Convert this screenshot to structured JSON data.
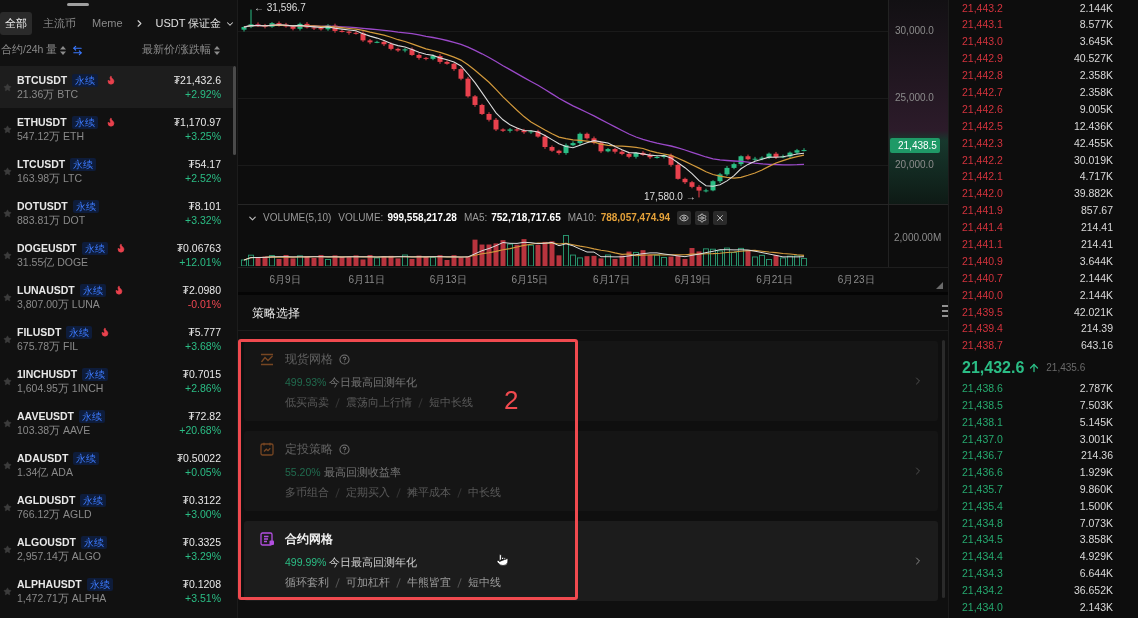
{
  "sidebar": {
    "tabs": [
      {
        "label": "全部",
        "selected": true
      },
      {
        "label": "主流币",
        "selected": false
      },
      {
        "label": "Meme",
        "selected": false
      }
    ],
    "market_select": {
      "label": "USDT 保证金"
    },
    "columns": {
      "left": "合约/24h 量",
      "right": "最新价/涨跌幅"
    },
    "rows": [
      {
        "symbol": "BTCUSDT",
        "tag": "永续",
        "hot": true,
        "volume": "21.36万 BTC",
        "price": "₮21,432.6",
        "change": "+2.92%",
        "rising": true,
        "starred": false,
        "selected": true
      },
      {
        "symbol": "ETHUSDT",
        "tag": "永续",
        "hot": true,
        "volume": "547.12万 ETH",
        "price": "₮1,170.97",
        "change": "+3.25%",
        "rising": true,
        "starred": false,
        "selected": false
      },
      {
        "symbol": "LTCUSDT",
        "tag": "永续",
        "hot": false,
        "volume": "163.98万 LTC",
        "price": "₮54.17",
        "change": "+2.52%",
        "rising": true,
        "starred": false,
        "selected": false
      },
      {
        "symbol": "DOTUSDT",
        "tag": "永续",
        "hot": false,
        "volume": "883.81万 DOT",
        "price": "₮8.101",
        "change": "+3.32%",
        "rising": true,
        "starred": false,
        "selected": false
      },
      {
        "symbol": "DOGEUSDT",
        "tag": "永续",
        "hot": true,
        "volume": "31.55亿 DOGE",
        "price": "₮0.06763",
        "change": "+12.01%",
        "rising": true,
        "starred": false,
        "selected": false
      },
      {
        "symbol": "LUNAUSDT",
        "tag": "永续",
        "hot": true,
        "volume": "3,807.00万 LUNA",
        "price": "₮2.0980",
        "change": "-0.01%",
        "rising": false,
        "starred": false,
        "selected": false
      },
      {
        "symbol": "FILUSDT",
        "tag": "永续",
        "hot": true,
        "volume": "675.78万 FIL",
        "price": "₮5.777",
        "change": "+3.68%",
        "rising": true,
        "starred": false,
        "selected": false
      },
      {
        "symbol": "1INCHUSDT",
        "tag": "永续",
        "hot": false,
        "volume": "1,604.95万 1INCH",
        "price": "₮0.7015",
        "change": "+2.86%",
        "rising": true,
        "starred": false,
        "selected": false
      },
      {
        "symbol": "AAVEUSDT",
        "tag": "永续",
        "hot": false,
        "volume": "103.38万 AAVE",
        "price": "₮72.82",
        "change": "+20.68%",
        "rising": true,
        "starred": false,
        "selected": false
      },
      {
        "symbol": "ADAUSDT",
        "tag": "永续",
        "hot": false,
        "volume": "1.34亿 ADA",
        "price": "₮0.50022",
        "change": "+0.05%",
        "rising": true,
        "starred": false,
        "selected": false
      },
      {
        "symbol": "AGLDUSDT",
        "tag": "永续",
        "hot": false,
        "volume": "766.12万 AGLD",
        "price": "₮0.3122",
        "change": "+3.00%",
        "rising": true,
        "starred": false,
        "selected": false
      },
      {
        "symbol": "ALGOUSDT",
        "tag": "永续",
        "hot": false,
        "volume": "2,957.14万 ALGO",
        "price": "₮0.3325",
        "change": "+3.29%",
        "rising": true,
        "starred": false,
        "selected": false
      },
      {
        "symbol": "ALPHAUSDT",
        "tag": "永续",
        "hot": false,
        "volume": "1,472.71万 ALPHA",
        "price": "₮0.1208",
        "change": "+3.51%",
        "rising": true,
        "starred": false,
        "selected": false
      }
    ]
  },
  "chart": {
    "high_label": "← 31,596.7",
    "low_label": "17,580.0 →",
    "price_ticks": [
      "30,000.0",
      "25,000.0",
      "20,000.0"
    ],
    "last_price": "21,438.5",
    "volume": {
      "title": "VOLUME(5,10)",
      "stats": [
        {
          "label": "VOLUME:",
          "value": "999,558,217.28",
          "color": "#ffffff"
        },
        {
          "label": "MA5:",
          "value": "752,718,717.65",
          "color": "#ffffff"
        },
        {
          "label": "MA10:",
          "value": "788,057,474.94",
          "color": "#e5a23a"
        }
      ],
      "tick": "2,000.00M"
    },
    "date_ticks": [
      "6月9日",
      "6月11日",
      "6月13日",
      "6月15日",
      "6月17日",
      "6月19日",
      "6月21日",
      "6月23日"
    ]
  },
  "strategies": {
    "title": "策略选择",
    "items": [
      {
        "kind": "spot_grid",
        "name": "现货网格",
        "help": true,
        "rate": "499.93%",
        "rate_label": "今日最高回测年化",
        "tags": [
          "低买高卖",
          "震荡向上行情",
          "短中长线"
        ],
        "dimmed": true
      },
      {
        "kind": "dca",
        "name": "定投策略",
        "help": true,
        "rate": "55.20%",
        "rate_label": "最高回测收益率",
        "tags": [
          "多币组合",
          "定期买入",
          "摊平成本",
          "中长线"
        ],
        "dimmed": true
      },
      {
        "kind": "futures_grid",
        "name": "合约网格",
        "help": false,
        "rate": "499.99%",
        "rate_label": "今日最高回测年化",
        "tags": [
          "循环套利",
          "可加杠杆",
          "牛熊皆宜",
          "短中线"
        ],
        "dimmed": false
      }
    ]
  },
  "annotation": {
    "label": "2"
  },
  "order_book": {
    "asks": [
      {
        "price": "21,443.2",
        "amount": "2.144K"
      },
      {
        "price": "21,443.1",
        "amount": "8.577K"
      },
      {
        "price": "21,443.0",
        "amount": "3.645K"
      },
      {
        "price": "21,442.9",
        "amount": "40.527K"
      },
      {
        "price": "21,442.8",
        "amount": "2.358K"
      },
      {
        "price": "21,442.7",
        "amount": "2.358K"
      },
      {
        "price": "21,442.6",
        "amount": "9.005K"
      },
      {
        "price": "21,442.5",
        "amount": "12.436K"
      },
      {
        "price": "21,442.3",
        "amount": "42.455K"
      },
      {
        "price": "21,442.2",
        "amount": "30.019K"
      },
      {
        "price": "21,442.1",
        "amount": "4.717K"
      },
      {
        "price": "21,442.0",
        "amount": "39.882K"
      },
      {
        "price": "21,441.9",
        "amount": "857.67"
      },
      {
        "price": "21,441.4",
        "amount": "214.41"
      },
      {
        "price": "21,441.1",
        "amount": "214.41"
      },
      {
        "price": "21,440.9",
        "amount": "3.644K"
      },
      {
        "price": "21,440.7",
        "amount": "2.144K"
      },
      {
        "price": "21,440.0",
        "amount": "2.144K"
      },
      {
        "price": "21,439.5",
        "amount": "42.021K"
      },
      {
        "price": "21,439.4",
        "amount": "214.39"
      },
      {
        "price": "21,438.7",
        "amount": "643.16"
      }
    ],
    "mid": {
      "price": "21,432.6",
      "rising": true,
      "index_price": "21,435.6"
    },
    "bids": [
      {
        "price": "21,438.6",
        "amount": "2.787K"
      },
      {
        "price": "21,438.5",
        "amount": "7.503K"
      },
      {
        "price": "21,438.1",
        "amount": "5.145K"
      },
      {
        "price": "21,437.0",
        "amount": "3.001K"
      },
      {
        "price": "21,436.7",
        "amount": "214.36"
      },
      {
        "price": "21,436.6",
        "amount": "1.929K"
      },
      {
        "price": "21,435.7",
        "amount": "9.860K"
      },
      {
        "price": "21,435.4",
        "amount": "1.500K"
      },
      {
        "price": "21,434.8",
        "amount": "7.073K"
      },
      {
        "price": "21,434.5",
        "amount": "3.858K"
      },
      {
        "price": "21,434.4",
        "amount": "4.929K"
      },
      {
        "price": "21,434.3",
        "amount": "6.644K"
      },
      {
        "price": "21,434.2",
        "amount": "36.652K"
      },
      {
        "price": "21,434.0",
        "amount": "2.143K"
      }
    ]
  }
}
